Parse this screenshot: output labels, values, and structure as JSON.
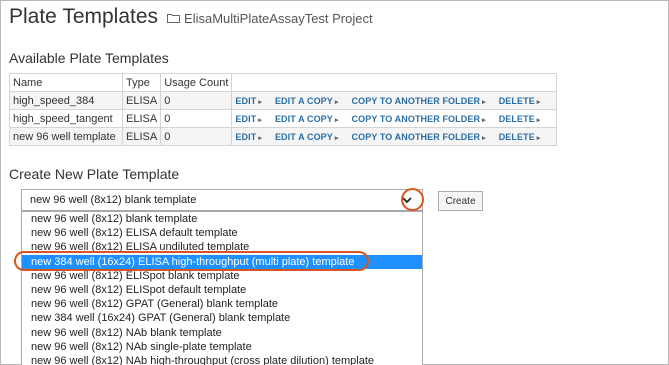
{
  "header": {
    "title": "Plate Templates",
    "project_link": "ElisaMultiPlateAssayTest Project"
  },
  "available": {
    "section_title": "Available Plate Templates",
    "columns": [
      "Name",
      "Type",
      "Usage Count",
      ""
    ],
    "rows": [
      {
        "name": "high_speed_384",
        "type": "ELISA",
        "usage": "0"
      },
      {
        "name": "high_speed_tangent",
        "type": "ELISA",
        "usage": "0"
      },
      {
        "name": "new 96 well template",
        "type": "ELISA",
        "usage": "0"
      }
    ],
    "actions": [
      "EDIT",
      "EDIT A COPY",
      "COPY TO ANOTHER FOLDER",
      "DELETE"
    ]
  },
  "create": {
    "section_title": "Create New Plate Template",
    "selected_value": "new 96 well (8x12) blank template",
    "button_label": "Create",
    "options": [
      "new 96 well (8x12) blank template",
      "new 96 well (8x12) ELISA default template",
      "new 96 well (8x12) ELISA undiluted template",
      "new 384 well (16x24) ELISA high-throughput (multi plate) template",
      "new 96 well (8x12) ELISpot blank template",
      "new 96 well (8x12) ELISpot default template",
      "new 96 well (8x12) GPAT (General) blank template",
      "new 384 well (16x24) GPAT (General) blank template",
      "new 96 well (8x12) NAb blank template",
      "new 96 well (8x12) NAb single-plate template",
      "new 96 well (8x12) NAb high-throughput (cross plate dilution) template"
    ],
    "highlighted_index": 3
  },
  "colors": {
    "link": "#2a6ea6",
    "callout": "#d9541e",
    "selection": "#1e90ff"
  },
  "icons": {
    "project": "folder-icon",
    "dropdown": "chevron-down-icon",
    "action": "caret-right-icon"
  }
}
